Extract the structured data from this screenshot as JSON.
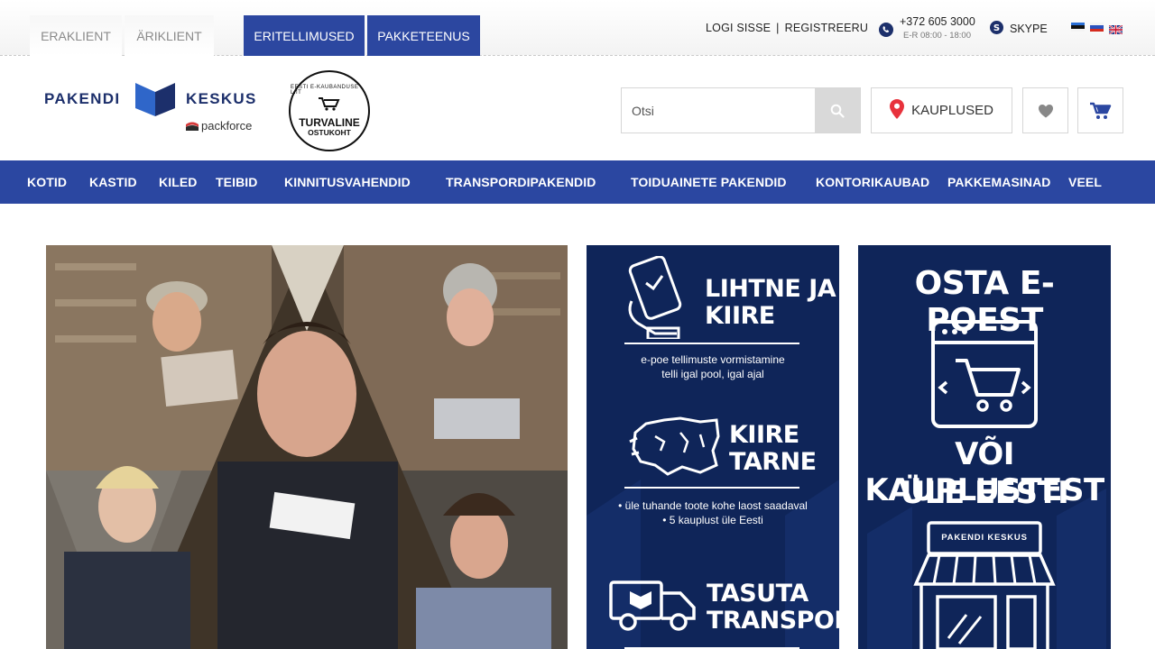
{
  "topbar": {
    "tabs": [
      {
        "label": "ERAKLIENT"
      },
      {
        "label": "ÄRIKLIENT"
      },
      {
        "label": "ERITELLIMUSED"
      },
      {
        "label": "PAKKETEENUS"
      }
    ],
    "login": "LOGI SISSE",
    "separator": "|",
    "register": "REGISTREERU",
    "phone": "+372 605 3000",
    "hours": "E-R 08:00 - 18:00",
    "skype": "SKYPE",
    "languages": [
      "et",
      "ru",
      "en"
    ]
  },
  "header": {
    "logo_word1": "PAKENDI",
    "logo_word2": "KESKUS",
    "logo_sub": "packforce",
    "badge_top": "EESTI E-KAUBANDUSE LIIT",
    "badge_main1": "TURVALINE",
    "badge_main2": "OSTUKOHT",
    "search_placeholder": "Otsi",
    "stores_label": "KAUPLUSED"
  },
  "nav": {
    "items": [
      "KOTID",
      "KASTID",
      "KILED",
      "TEIBID",
      "KINNITUSVAHENDID",
      "TRANSPORDIPAKENDID",
      "TOIDUAINETE PAKENDID",
      "KONTORIKAUBAD",
      "PAKKEMASINAD",
      "VEEL"
    ]
  },
  "promo1": {
    "h1a": "LIHTNE JA",
    "h1b": "KIIRE",
    "s1a": "e-poe tellimuste vormistamine",
    "s1b": "telli igal pool, igal ajal",
    "h2a": "KIIRE",
    "h2b": "TARNE",
    "s2a": "• üle tuhande toote kohe laost saadaval",
    "s2b": "• 5 kauplust üle Eesti",
    "h3a": "TASUTA",
    "h3b": "TRANSPORT"
  },
  "promo2": {
    "title": "OSTA E-POEST",
    "line1": "VÕI KAUPLUSTEST",
    "line2": "ÜLE EESTI",
    "sign": "PAKENDI KESKUS"
  },
  "colors": {
    "brand_blue": "#2b47a1",
    "navy": "#0f2559",
    "pin_red": "#e8323c"
  }
}
